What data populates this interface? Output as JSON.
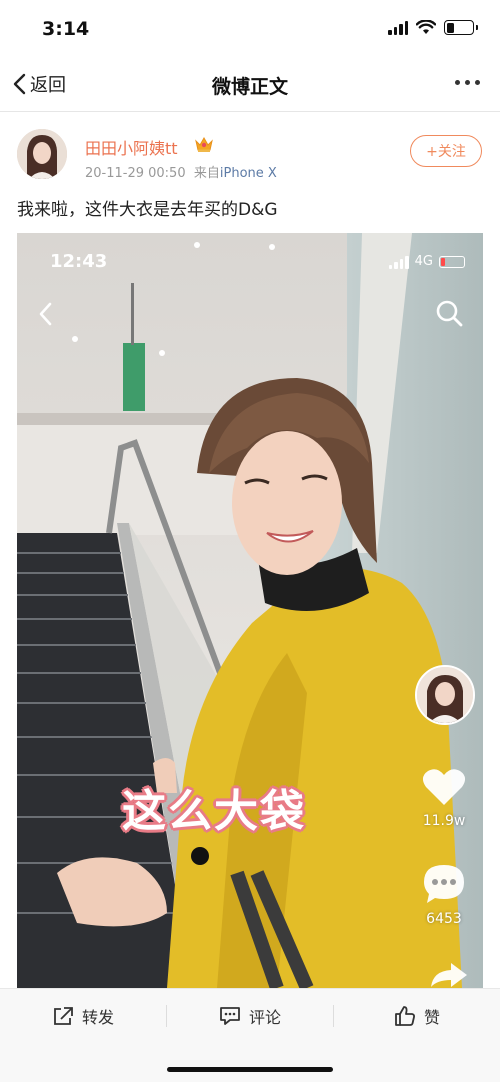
{
  "status_bar": {
    "time": "3:14"
  },
  "nav": {
    "back_label": "返回",
    "title": "微博正文"
  },
  "post": {
    "author": "田田小阿姨tt",
    "timestamp": "20-11-29 00:50",
    "source_prefix": "来自",
    "source_device": "iPhone X",
    "follow_label": "+关注",
    "text": "我来啦，这件大衣是去年买的D&G"
  },
  "video": {
    "time": "12:43",
    "network": "4G",
    "caption": "这么大袋",
    "likes": "11.9w",
    "comments": "6453"
  },
  "toolbar": {
    "repost": "转发",
    "comment": "评论",
    "like": "赞"
  },
  "colors": {
    "accent": "#eb7350",
    "follow": "#f08a5d",
    "link": "#5d7ba6",
    "coat": "#e3bd28"
  },
  "icons": [
    "chevron-left-icon",
    "more-icon",
    "crown-icon",
    "search-icon",
    "heart-icon",
    "comment-bubble-icon",
    "share-arrow-icon",
    "repost-icon",
    "comment-icon",
    "thumbs-up-icon"
  ]
}
